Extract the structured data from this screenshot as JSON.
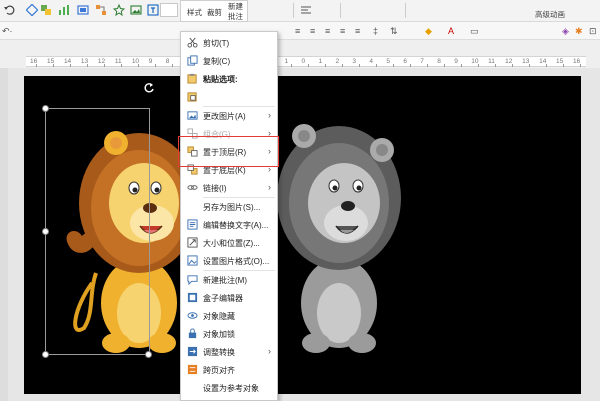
{
  "ribbon": {
    "mini_toolbar": {
      "style_label": "样式",
      "crop_label": "裁剪",
      "new_label": "新建",
      "comment_label": "批注"
    },
    "advanced_animation": "高级动画"
  },
  "ruler": {
    "labels": [
      "16",
      "15",
      "14",
      "13",
      "12",
      "11",
      "10",
      "9",
      "8",
      "7",
      "6",
      "5",
      "4",
      "3",
      "2",
      "1",
      "0",
      "1",
      "2",
      "3",
      "4",
      "5",
      "6",
      "7",
      "8",
      "9",
      "10",
      "11",
      "12",
      "13",
      "14",
      "15",
      "16"
    ]
  },
  "context_menu": {
    "items": [
      {
        "label": "剪切(T)",
        "icon": "scissors-icon",
        "enabled": true
      },
      {
        "label": "复制(C)",
        "icon": "copy-icon",
        "enabled": true
      },
      {
        "label": "粘贴选项:",
        "icon": "paste-icon",
        "enabled": true,
        "bold": true
      },
      {
        "label": "",
        "icon": "paste-picture-icon",
        "enabled": true
      },
      {
        "label": "更改图片(A)",
        "icon": "change-picture-icon",
        "enabled": true,
        "submenu": true
      },
      {
        "label": "组合(G)",
        "icon": "group-icon",
        "enabled": false,
        "submenu": true
      },
      {
        "label": "置于顶层(R)",
        "icon": "bring-to-front-icon",
        "enabled": true,
        "submenu": true
      },
      {
        "label": "置于底层(K)",
        "icon": "send-to-back-icon",
        "enabled": true,
        "submenu": true
      },
      {
        "label": "链接(I)",
        "icon": "link-icon",
        "enabled": true,
        "submenu": true
      },
      {
        "label": "另存为图片(S)...",
        "icon": "",
        "enabled": true
      },
      {
        "label": "编辑替换文字(A)...",
        "icon": "alt-text-icon",
        "enabled": true
      },
      {
        "label": "大小和位置(Z)...",
        "icon": "size-position-icon",
        "enabled": true
      },
      {
        "label": "设置图片格式(O)...",
        "icon": "format-picture-icon",
        "enabled": true
      },
      {
        "label": "新建批注(M)",
        "icon": "comment-icon",
        "enabled": true
      },
      {
        "label": "盒子编辑器",
        "icon": "box-editor-icon",
        "enabled": true
      },
      {
        "label": "对象隐藏",
        "icon": "eye-icon",
        "enabled": true
      },
      {
        "label": "对象加锁",
        "icon": "lock-icon",
        "enabled": true
      },
      {
        "label": "调整转换",
        "icon": "convert-icon",
        "enabled": true,
        "submenu": true
      },
      {
        "label": "跨页对齐",
        "icon": "align-icon",
        "enabled": true
      },
      {
        "label": "设置为参考对象",
        "icon": "",
        "enabled": true
      }
    ]
  },
  "colors": {
    "highlight": "#e53935",
    "slide_bg": "#000000",
    "lion_mane": "#b5651d",
    "lion_body": "#f0b22e"
  }
}
